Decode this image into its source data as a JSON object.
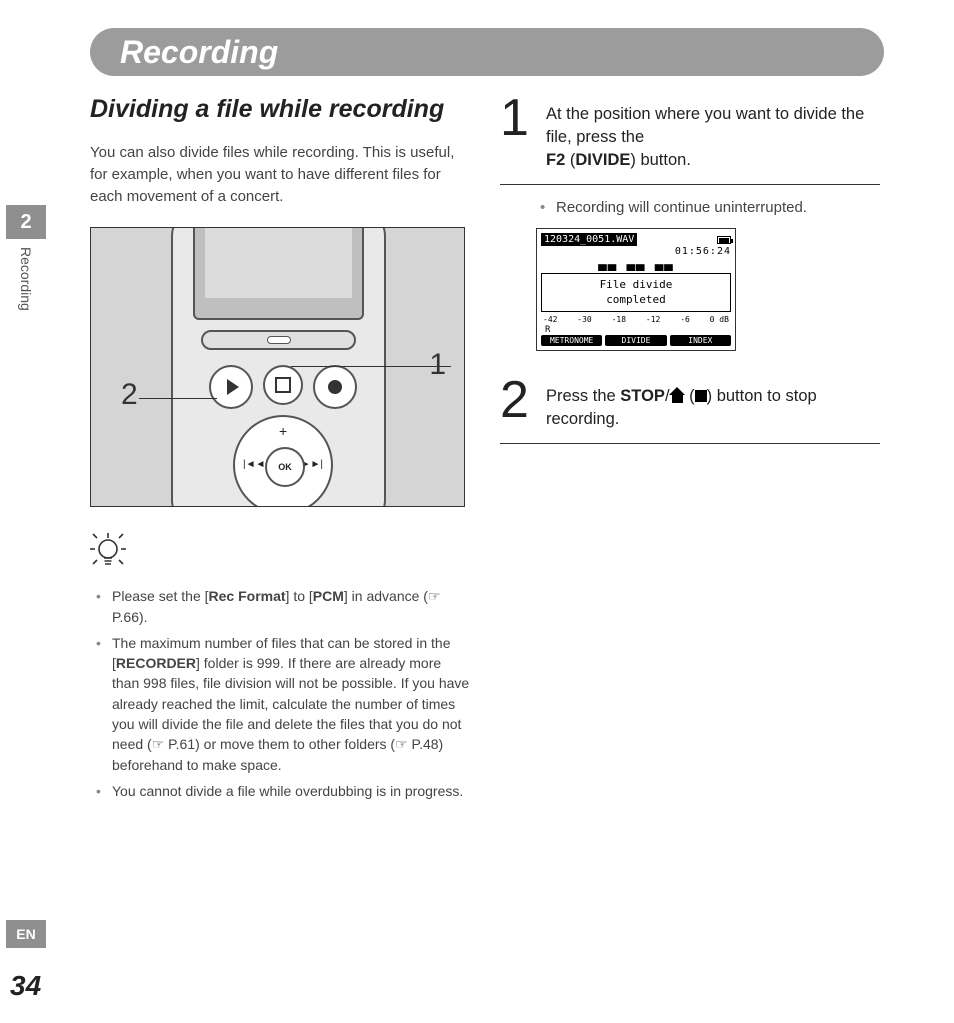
{
  "header": {
    "title": "Recording"
  },
  "side": {
    "chapter_num": "2",
    "chapter_label": "Recording",
    "lang": "EN",
    "page": "34"
  },
  "left": {
    "subhead": "Dividing a file while recording",
    "intro": "You can also divide files while recording. This is useful, for example, when you want to have different files for each movement of a concert.",
    "callout1": "1",
    "callout2": "2",
    "ok_label": "OK",
    "tips": {
      "t1a": "Please set the [",
      "t1b": "Rec Format",
      "t1c": "] to [",
      "t1d": "PCM",
      "t1e": "] in advance (☞ P.66).",
      "t2a": "The maximum number of files that can be stored in the [",
      "t2b": "RECORDER",
      "t2c": "] folder is 999. If there are already more than 998 files, file division will not be possible. If you have already reached the limit, calculate the number of times you will divide the file and delete the files that you do not need (☞ P.61) or move them to other folders (☞ P.48) beforehand to make space.",
      "t3": "You cannot divide a file while overdubbing is in progress."
    }
  },
  "right": {
    "step1": {
      "num": "1",
      "line1": "At the position where you want to divide the file, press the",
      "f2": "F2",
      "paren_open": "  (",
      "divide": "DIVIDE",
      "paren_close": ") button.",
      "sub": "Recording will continue uninterrupted."
    },
    "lcd": {
      "file": "120324_0051.WAV",
      "time": "01:56:24",
      "bigtime": "▄▄ ▄▄ ▄▄",
      "msg1": "File divide",
      "msg2": "completed",
      "scale": [
        "-42",
        "-30",
        "-18",
        "-12",
        "-6",
        "0 dB"
      ],
      "r": "R",
      "b1": "METRONOME",
      "b2": "DIVIDE",
      "b3": "INDEX"
    },
    "step2": {
      "num": "2",
      "pre": "Press the ",
      "stop": "STOP",
      "slash": "/",
      "post": ") button to stop recording."
    }
  }
}
